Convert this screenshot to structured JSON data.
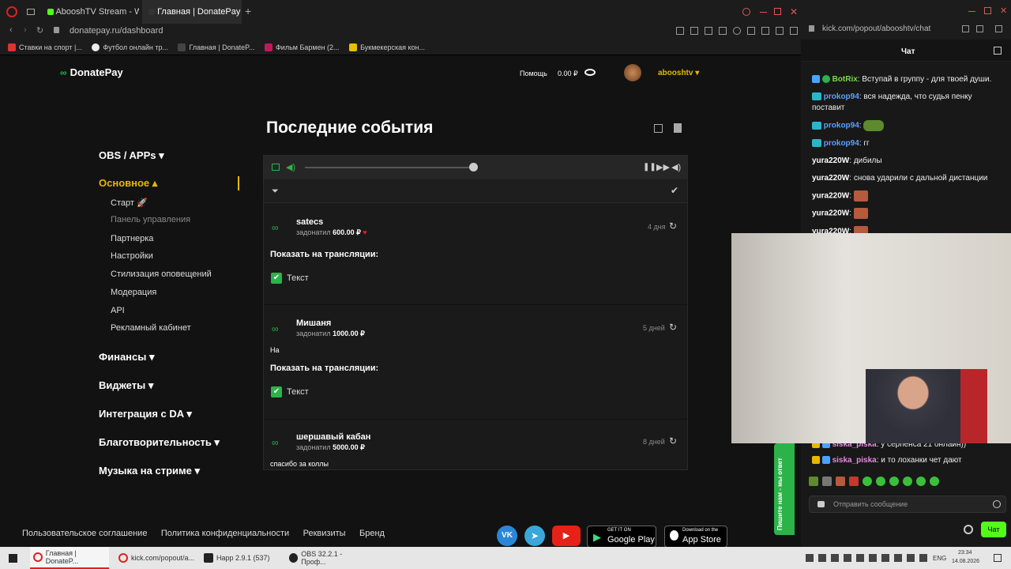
{
  "browser": {
    "tabs": [
      {
        "label": "AbooshTV Stream - Watch"
      },
      {
        "label": "Главная | DonatePay"
      }
    ],
    "url": "donatepay.ru/dashboard",
    "bookmarks": [
      "Ставки на спорт |...",
      "Футбол онлайн тр...",
      "Главная | DonateP...",
      "Фильм Бармен (2...",
      "Букмекерская кон..."
    ]
  },
  "header": {
    "logo": "DonatePay",
    "help": "Помощь",
    "balance": "0.00 ₽",
    "user": "abooshtv"
  },
  "sidebar": {
    "groups": [
      {
        "label": "OBS / APPs"
      },
      {
        "label": "Основное"
      },
      {
        "label": "Финансы"
      },
      {
        "label": "Виджеты"
      },
      {
        "label": "Интеграция с DA"
      },
      {
        "label": "Благотворительность"
      },
      {
        "label": "Музыка на стриме"
      }
    ],
    "items": [
      "Старт",
      "Панель управления",
      "Партнерка",
      "Настройки",
      "Стилизация оповещений",
      "Модерация",
      "API",
      "Рекламный кабинет"
    ]
  },
  "main": {
    "title": "Последние события",
    "events": [
      {
        "name": "satecs",
        "verb": "задонатил",
        "amount": "600.00 ₽",
        "time": "4 дня",
        "message": "",
        "show_label": "Показать на трансляции:",
        "check_label": "Текст"
      },
      {
        "name": "Мишаня",
        "verb": "задонатил",
        "amount": "1000.00 ₽",
        "time": "5 дней",
        "message": "На",
        "show_label": "Показать на трансляции:",
        "check_label": "Текст"
      },
      {
        "name": "шершавый кабан",
        "verb": "задонатил",
        "amount": "5000.00 ₽",
        "time": "8 дней",
        "message": "спасибо за коллы"
      }
    ]
  },
  "footer": {
    "links": [
      "Пользовательское соглашение",
      "Политика конфиденциальности",
      "Реквизиты",
      "Бренд"
    ],
    "google_small": "GET IT ON",
    "google": "Google Play",
    "apple_small": "Download on the",
    "apple": "App Store"
  },
  "chat": {
    "url": "kick.com/popout/abooshtv/chat",
    "title": "Чат",
    "messages": [
      {
        "user": "BotRix",
        "text": "Вступай в группу - для твоей души.",
        "color": "#7bd94a"
      },
      {
        "user": "prokop94",
        "text": "вся надежда, что судья пенку поставит",
        "color": "#5aa0ff"
      },
      {
        "user": "prokop94",
        "text": "",
        "color": "#5aa0ff"
      },
      {
        "user": "prokop94",
        "text": "гг",
        "color": "#5aa0ff"
      },
      {
        "user": "yura220W",
        "text": "дибилы",
        "color": "#ffffff"
      },
      {
        "user": "yura220W",
        "text": "снова ударили с дальной дистанции",
        "color": "#ffffff"
      },
      {
        "user": "yura220W",
        "text": "",
        "color": "#ffffff"
      },
      {
        "user": "yura220W",
        "text": "",
        "color": "#ffffff"
      },
      {
        "user": "yura220W",
        "text": "",
        "color": "#ffffff"
      },
      {
        "user": "siska_piska",
        "text": "у серпенса 21 онлайн))",
        "color": "#e58ae0"
      },
      {
        "user": "siska_piska",
        "text": "и то лоханки чет дают",
        "color": "#e58ae0"
      }
    ],
    "input_placeholder": "Отправить сообщение",
    "send": "Чат",
    "side_banner": "Пишите нам - мы ответ"
  },
  "taskbar": {
    "apps": [
      "Главная | DonateP...",
      "kick.com/popout/a...",
      "Happ 2.9.1 (537)",
      "OBS 32.2.1 - Проф..."
    ],
    "lang": "ENG",
    "time": "23:34",
    "date": "14.08.2026"
  },
  "colors": {
    "accent": "#e6b800",
    "green": "#2bb34a",
    "kick": "#53fc18"
  }
}
